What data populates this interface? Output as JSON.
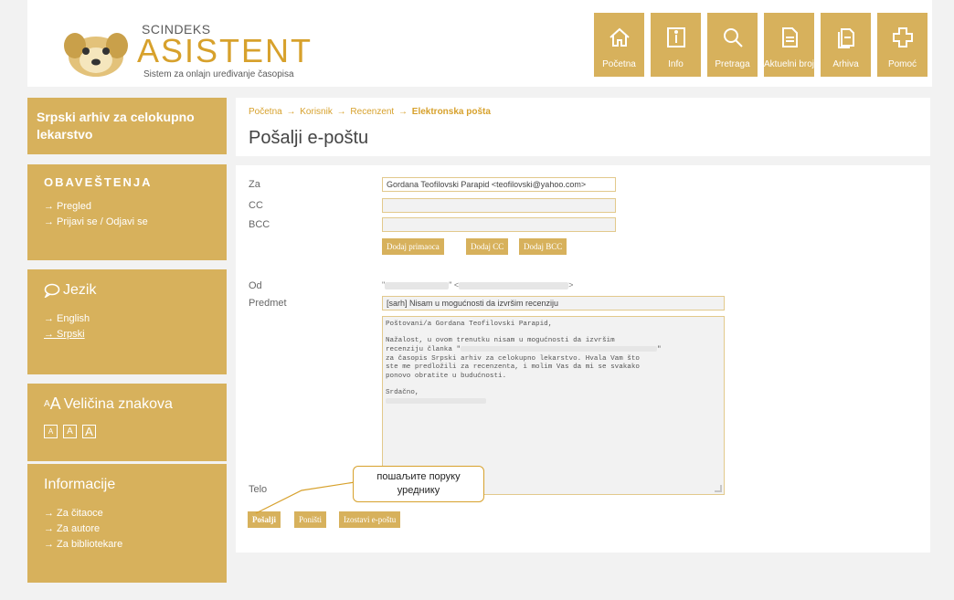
{
  "logo": {
    "brand": "SCINDEKS",
    "title": "ASISTENT",
    "subtitle": "Sistem za onlajn uređivanje časopisa"
  },
  "nav": [
    {
      "label": "Početna",
      "icon": "home-icon"
    },
    {
      "label": "Info",
      "icon": "info-icon"
    },
    {
      "label": "Pretraga",
      "icon": "search-icon"
    },
    {
      "label": "Aktuelni broj",
      "icon": "document-icon"
    },
    {
      "label": "Arhiva",
      "icon": "archive-icon"
    },
    {
      "label": "Pomoć",
      "icon": "help-icon"
    }
  ],
  "sidebar": {
    "journal": "Srpski arhiv za celokupno lekarstvo",
    "notices": {
      "title": "OBAVEŠTENJA",
      "links": [
        "→ Pregled",
        "→ Prijavi se / Odjavi se"
      ]
    },
    "language": {
      "title": "Jezik",
      "links": [
        "→ English",
        "→ Srpski"
      ]
    },
    "fontsize": {
      "title": "Veličina znakova",
      "small_prefix": "A",
      "big_prefix": "A"
    },
    "info": {
      "title": "Informacije",
      "links": [
        "→ Za čitaoce",
        "→ Za autore",
        "→ Za bibliotekare"
      ]
    }
  },
  "breadcrumb": {
    "items": [
      "Početna",
      "Korisnik",
      "Recenzent"
    ],
    "current": "Elektronska pošta",
    "separator": "→"
  },
  "page_title": "Pošalji e-poštu",
  "form": {
    "to_label": "Za",
    "to_value": "Gordana Teofilovski Parapid <teofilovski@yahoo.com>",
    "cc_label": "CC",
    "bcc_label": "BCC",
    "add_recipient": "Dodaj primaoca",
    "add_cc": "Dodaj CC",
    "add_bcc": "Dodaj BCC",
    "from_label": "Od",
    "from_quote": "\"",
    "from_mid": "\" <",
    "from_end": ">",
    "subject_label": "Predmet",
    "subject_value": "[sarh] Nisam u mogućnosti da izvršim recenziju",
    "body_label": "Telo",
    "body": {
      "greeting": "Poštovani/a Gordana Teofilovski Parapid,",
      "line1": "Nažalost, u ovom trenutku nisam u mogućnosti da izvršim",
      "line2a": "recenziju članka \"",
      "line2b": "\"",
      "line3": "za časopis Srpski arhiv za celokupno lekarstvo. Hvala Vam što",
      "line4": "ste me predložili za recenzenta, i molim Vas da mi se svakako",
      "line5": "ponovo obratite u budućnosti.",
      "closing": "Srdačno,"
    },
    "send": "Pošalji",
    "cancel": "Poništi",
    "skip": "Izostavi e-poštu"
  },
  "callout": {
    "line1": "пошаљите поруку",
    "line2": "уреднику"
  },
  "colors": {
    "accent": "#d7b15c",
    "accent_text": "#d7a12c",
    "callout_border": "#d7a12c"
  }
}
